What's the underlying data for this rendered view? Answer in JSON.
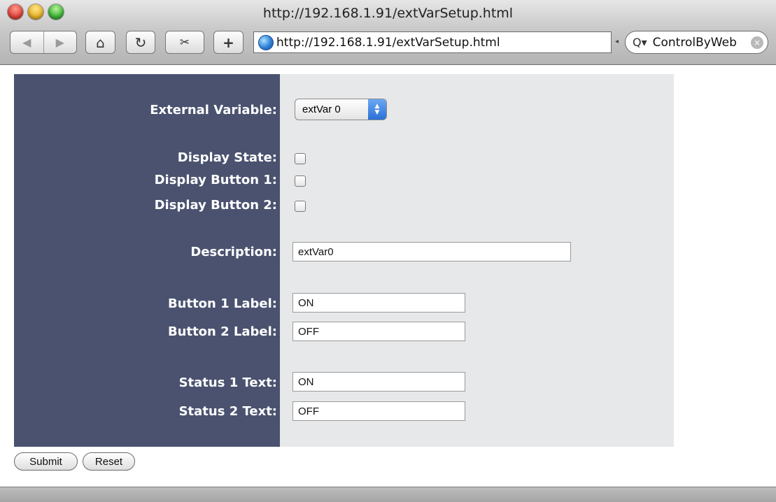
{
  "browser": {
    "title": "http://192.168.1.91/extVarSetup.html",
    "url": "http://192.168.1.91/extVarSetup.html",
    "search_text": "ControlByWeb"
  },
  "form": {
    "labels": {
      "external_variable": "External Variable:",
      "display_state": "Display State:",
      "display_button1": "Display Button 1:",
      "display_button2": "Display Button 2:",
      "description": "Description:",
      "button1_label": "Button 1 Label:",
      "button2_label": "Button 2 Label:",
      "status1_text": "Status 1 Text:",
      "status2_text": "Status 2 Text:"
    },
    "values": {
      "external_variable": "extVar 0",
      "description": "extVar0",
      "button1_label": "ON",
      "button2_label": "OFF",
      "status1_text": "ON",
      "status2_text": "OFF"
    },
    "buttons": {
      "submit": "Submit",
      "reset": "Reset"
    }
  }
}
